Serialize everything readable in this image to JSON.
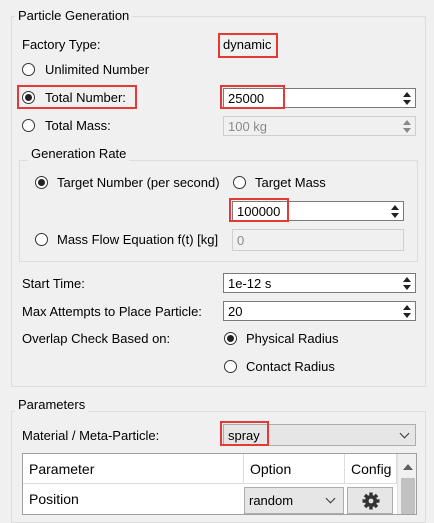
{
  "particle_generation": {
    "title": "Particle Generation",
    "factory_type_label": "Factory Type:",
    "factory_type_value": "dynamic",
    "unlimited_number_label": "Unlimited Number",
    "total_number_label": "Total Number:",
    "total_number_value": "25000",
    "total_mass_label": "Total Mass:",
    "total_mass_value": "100 kg",
    "selected_mode": "Total Number"
  },
  "generation_rate": {
    "title": "Generation Rate",
    "target_number_label": "Target Number (per second)",
    "target_mass_label": "Target Mass",
    "rate_value": "100000",
    "mass_flow_label": "Mass Flow Equation f(t) [kg]",
    "mass_flow_value": "0",
    "selected_mode": "Target Number (per second)"
  },
  "timing": {
    "start_time_label": "Start Time:",
    "start_time_value": "1e-12 s",
    "max_attempts_label": "Max Attempts to Place Particle:",
    "max_attempts_value": "20",
    "overlap_label": "Overlap Check Based on:",
    "physical_radius_label": "Physical Radius",
    "contact_radius_label": "Contact Radius",
    "overlap_selected": "Physical Radius"
  },
  "parameters": {
    "title": "Parameters",
    "material_label": "Material / Meta-Particle:",
    "material_value": "spray",
    "table": {
      "columns": [
        "Parameter",
        "Option",
        "Config"
      ],
      "rows": [
        {
          "parameter": "Position",
          "option": "random",
          "config_icon": "gear-icon"
        }
      ]
    }
  },
  "colors": {
    "highlight": "#e53935",
    "background": "#f0f0f0"
  }
}
